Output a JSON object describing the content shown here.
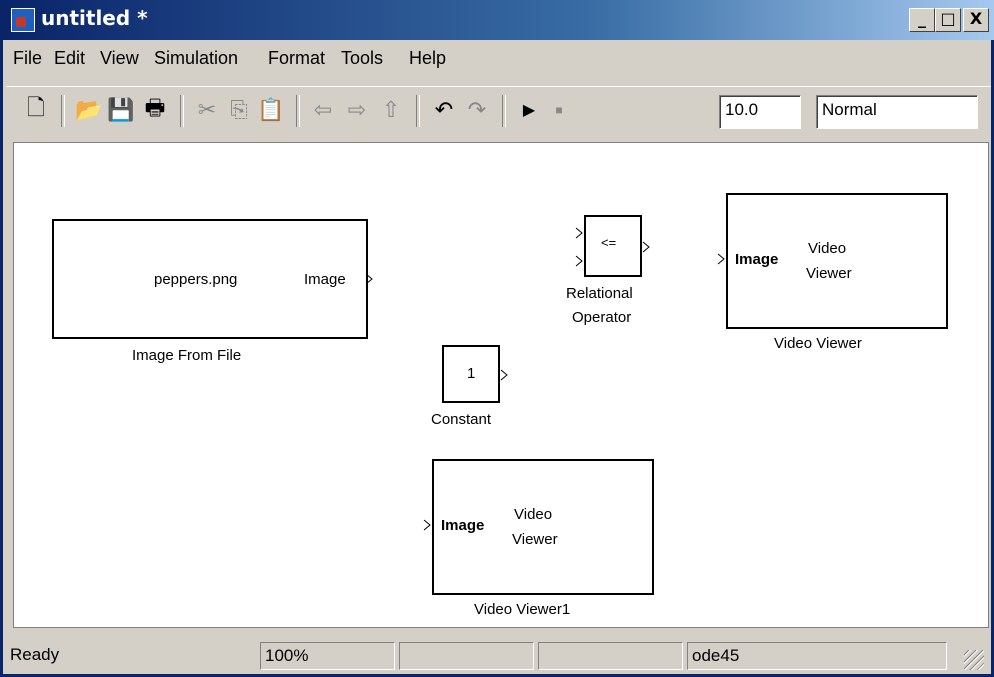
{
  "window": {
    "title": "untitled *",
    "minimize": "_",
    "maximize": "□",
    "close": "X"
  },
  "menu": [
    "File",
    "Edit",
    "View",
    "Simulation",
    "Format",
    "Tools",
    "Help"
  ],
  "toolbar": {
    "icons": [
      "new-icon",
      "open-icon",
      "save-icon",
      "print-icon",
      "cut-icon",
      "copy-icon",
      "paste-icon",
      "back-icon",
      "forward-icon",
      "up-icon",
      "undo-icon",
      "redo-icon",
      "play-icon",
      "stop-icon"
    ],
    "stop_time": "10.0",
    "sim_mode": "Normal"
  },
  "blocks": {
    "image_from_file": {
      "content": "peppers.png",
      "port": "Image",
      "label": "Image From File"
    },
    "relational_operator": {
      "symbol": "<=",
      "label_line1": "Relational",
      "label_line2": "Operator"
    },
    "constant": {
      "value": "1",
      "label": "Constant"
    },
    "video_viewer": {
      "port": "Image",
      "title_line1": "Video",
      "title_line2": "Viewer",
      "label": "Video Viewer"
    },
    "video_viewer1": {
      "port": "Image",
      "title_line1": "Video",
      "title_line2": "Viewer",
      "label": "Video Viewer1"
    }
  },
  "status": {
    "state": "Ready",
    "zoom": "100%",
    "solver": "ode45"
  }
}
